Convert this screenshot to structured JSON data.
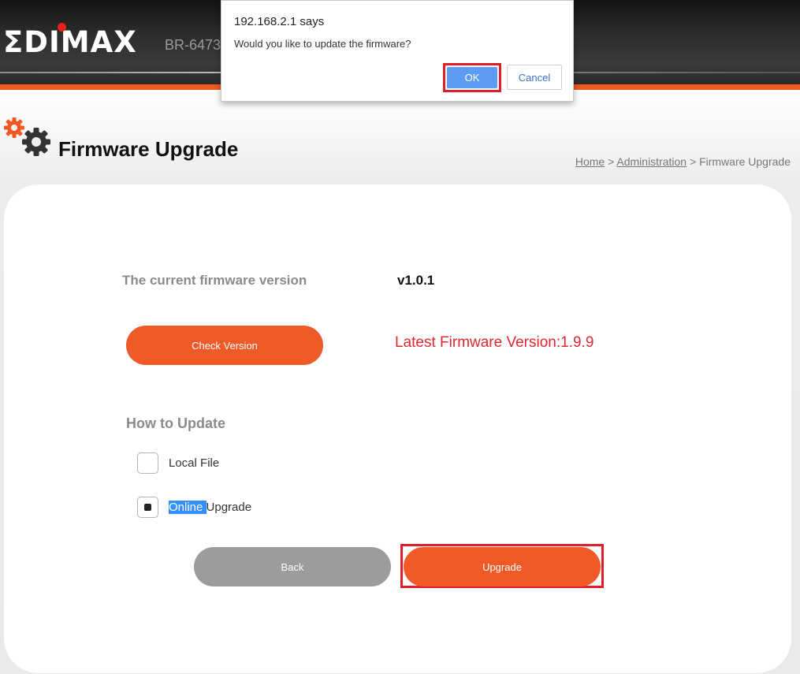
{
  "header": {
    "logo_text": "ΣDIMAX",
    "model": "BR-6473"
  },
  "page": {
    "title": "Firmware Upgrade"
  },
  "breadcrumb": {
    "home": "Home",
    "sep1": " > ",
    "admin": "Administration",
    "sep2": " > ",
    "current": "Firmware Upgrade"
  },
  "firmware": {
    "current_label": "The current firmware version",
    "current_version": "v1.0.1",
    "check_button": "Check Version",
    "latest_text": "Latest Firmware Version:1.9.9"
  },
  "update": {
    "title": "How to Update",
    "options": [
      {
        "label": "Local File",
        "selected": false
      },
      {
        "label_highlight": "Online ",
        "label_rest": "Upgrade",
        "selected": true
      }
    ]
  },
  "actions": {
    "back": "Back",
    "upgrade": "Upgrade"
  },
  "dialog": {
    "title": "192.168.2.1 says",
    "message": "Would you like to update the firmware?",
    "ok": "OK",
    "cancel": "Cancel"
  },
  "colors": {
    "accent": "#f05a22",
    "highlight_box": "#e01e29",
    "latest_text": "#e3262c",
    "ok_button": "#5c9cf4"
  }
}
